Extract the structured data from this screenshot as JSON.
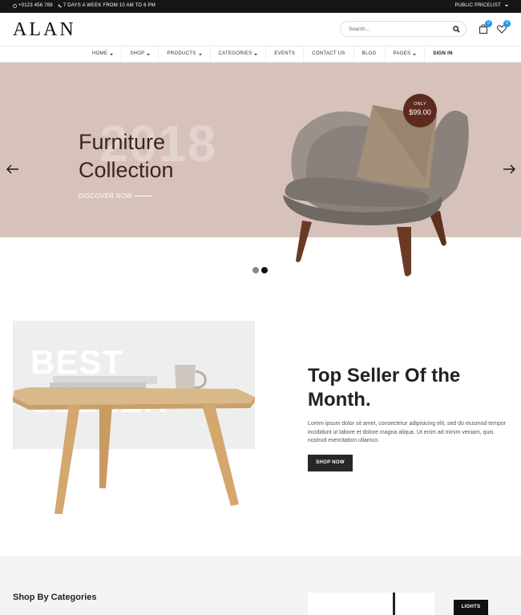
{
  "topbar": {
    "phone": "+0123 456 789",
    "hours": "7 DAYS A WEEK FROM 10 AM TO 6 PM",
    "pricelist": "PUBLIC PRICELIST"
  },
  "header": {
    "logo": "ALAN",
    "search_placeholder": "Search...",
    "cart_count": "0",
    "wishlist_count": "0"
  },
  "nav": {
    "items": [
      {
        "label": "HOME"
      },
      {
        "label": "SHOP"
      },
      {
        "label": "PRODUCTS"
      },
      {
        "label": "CATEGORIES"
      },
      {
        "label": "EVENTS"
      },
      {
        "label": "CONTACT US"
      },
      {
        "label": "BLOG"
      },
      {
        "label": "PAGES"
      },
      {
        "label": "SIGN IN"
      }
    ]
  },
  "hero": {
    "ghost_year": "2018",
    "title_line1": "Furniture",
    "title_line2": "Collection",
    "discover": "DISCOVER NOW",
    "badge_only": "ONLY",
    "badge_price": "$99.00",
    "slides": 2,
    "active_slide": 2
  },
  "best_seller": {
    "ghost_text": "BEST SELLER",
    "title": "Top Seller Of the Month.",
    "text": "Lorem ipsum dolor sit amet, consectetur adipisicing elit, sed do eiusmod tempor incididunt ut labore et dolore magna aliqua. Ut enim ad minim veniam, quis nostrud exercitation ullamco.",
    "button": "SHOP NOW"
  },
  "categories": {
    "title": "Shop By Categories",
    "label": "LIGHTS"
  },
  "colors": {
    "hero_bg": "#d7c2bb",
    "accent_badge": "#5d2a1f",
    "title_brown": "#3f2418",
    "badge_blue": "#1e9be6"
  }
}
